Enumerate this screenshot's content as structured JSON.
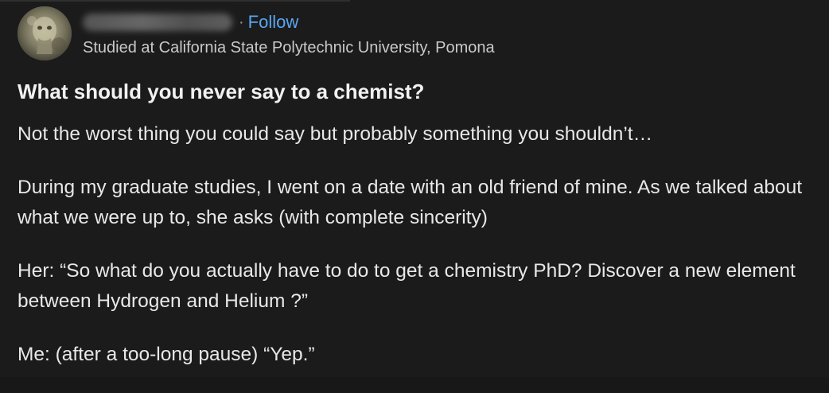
{
  "author": {
    "name_redacted": true,
    "separator": "·",
    "follow_label": "Follow",
    "credential": "Studied at California State Polytechnic University, Pomona"
  },
  "question": "What should you never say to a chemist?",
  "paragraphs": [
    "Not the worst thing you could say but probably something you shouldn’t…",
    "During my graduate studies, I went on a date with an old friend of mine. As we talked about what we were up to, she asks (with complete sincerity)",
    "Her: “So what do you actually have to do to get a chemistry PhD? Discover a new element between Hydrogen and Helium ?”",
    "Me: (after a too-long pause) “Yep.”"
  ],
  "colors": {
    "background": "#1b1b1b",
    "link": "#5aa6f2",
    "text": "#e8e8e8"
  }
}
